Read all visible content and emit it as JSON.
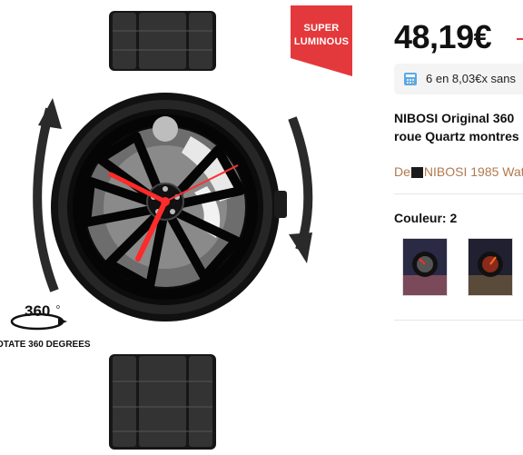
{
  "badge": {
    "line1": "SUPER",
    "line2": "LUMINOUS"
  },
  "rotate": {
    "number": "360",
    "caption": "OTATE 360 DEGREES"
  },
  "price": {
    "current": "48,19€"
  },
  "installment": {
    "text": "6 en 8,03€x sans"
  },
  "title": {
    "line1": "NIBOSI Original 360",
    "line2": "roue Quartz montres"
  },
  "store": {
    "prefix": "De",
    "name": "NIBOSI 1985 Wat"
  },
  "color": {
    "label": "Couleur: 2"
  },
  "colors": {
    "accent": "#e4393c",
    "badge": "#e4393c",
    "link": "#b07a4f",
    "watch": "#1a1a1a"
  }
}
